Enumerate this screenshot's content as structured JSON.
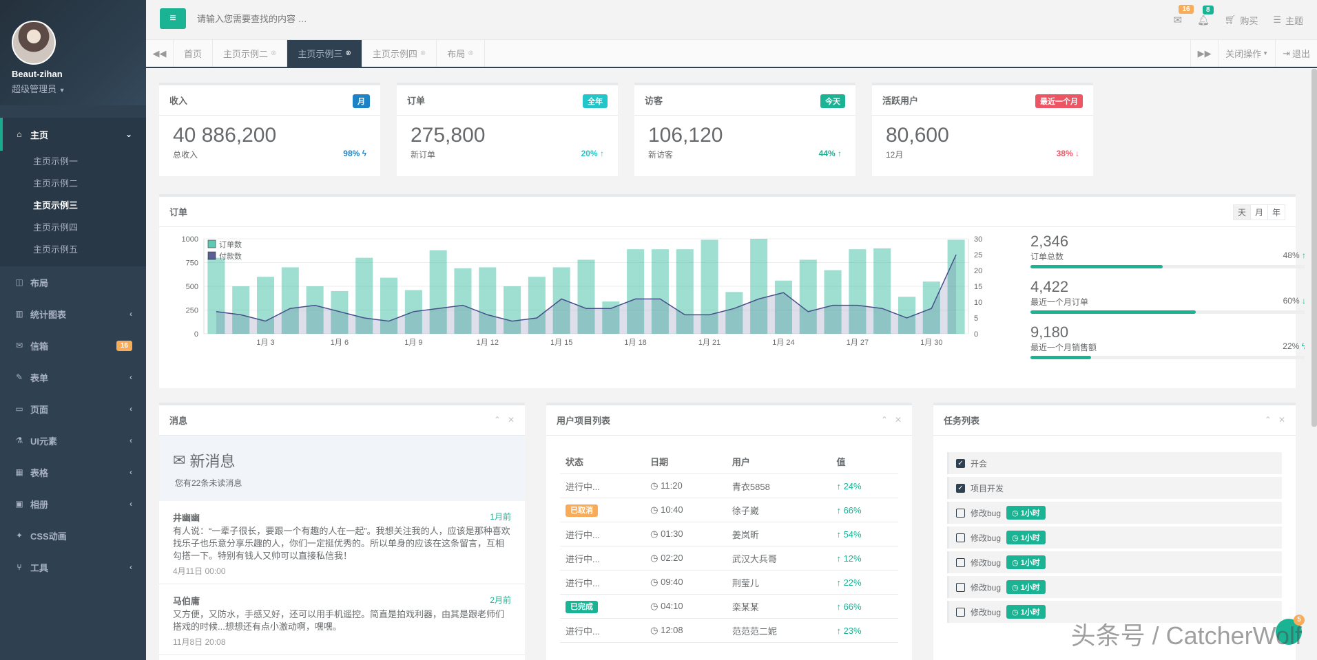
{
  "profile": {
    "name": "Beaut-zihan",
    "role": "超级管理员"
  },
  "sidebar": {
    "home": "主页",
    "home_sub": [
      "主页示例一",
      "主页示例二",
      "主页示例三",
      "主页示例四",
      "主页示例五"
    ],
    "items": [
      {
        "label": "布局",
        "icon": "layout-icon"
      },
      {
        "label": "统计图表",
        "icon": "chart-icon"
      },
      {
        "label": "信箱",
        "icon": "mail-icon",
        "badge": "16"
      },
      {
        "label": "表单",
        "icon": "edit-icon"
      },
      {
        "label": "页面",
        "icon": "desktop-icon"
      },
      {
        "label": "UI元素",
        "icon": "flask-icon"
      },
      {
        "label": "表格",
        "icon": "table-icon"
      },
      {
        "label": "相册",
        "icon": "picture-icon"
      },
      {
        "label": "CSS动画",
        "icon": "magic-icon"
      },
      {
        "label": "工具",
        "icon": "cutlery-icon"
      }
    ]
  },
  "topbar": {
    "search_placeholder": "请输入您需要查找的内容 …",
    "mail_count": "16",
    "bell_count": "8",
    "buy": "购买",
    "theme": "主题"
  },
  "tabs": {
    "items": [
      "首页",
      "主页示例二",
      "主页示例三",
      "主页示例四",
      "布局"
    ],
    "close_ops": "关闭操作",
    "logout": "退出"
  },
  "stats": [
    {
      "title": "收入",
      "label": "月",
      "label_color": "#1c84c6",
      "value": "40 886,200",
      "sub": "总收入",
      "pct": "98%",
      "pct_color": "#1c84c6",
      "arrow": "ϟ"
    },
    {
      "title": "订单",
      "label": "全年",
      "label_color": "#23c6c8",
      "value": "275,800",
      "sub": "新订单",
      "pct": "20%",
      "pct_color": "#23c6c8",
      "arrow": "↑"
    },
    {
      "title": "访客",
      "label": "今天",
      "label_color": "#1ab394",
      "value": "106,120",
      "sub": "新访客",
      "pct": "44%",
      "pct_color": "#1ab394",
      "arrow": "↑"
    },
    {
      "title": "活跃用户",
      "label": "最近一个月",
      "label_color": "#ed5565",
      "value": "80,600",
      "sub": "12月",
      "pct": "38%",
      "pct_color": "#ed5565",
      "arrow": "↓"
    }
  ],
  "orders_panel": {
    "title": "订单",
    "range_buttons": [
      "天",
      "月",
      "年"
    ],
    "side_stats": [
      {
        "value": "2,346",
        "label": "订单总数",
        "pct": "48%",
        "fill": 0.48,
        "arrow": "↑"
      },
      {
        "value": "4,422",
        "label": "最近一个月订单",
        "pct": "60%",
        "fill": 0.6,
        "arrow": "↓"
      },
      {
        "value": "9,180",
        "label": "最近一个月销售额",
        "pct": "22%",
        "fill": 0.22,
        "arrow": "ϟ"
      }
    ]
  },
  "chart_data": {
    "type": "bar",
    "x_tick_labels": [
      "1月 3",
      "1月 6",
      "1月 9",
      "1月 12",
      "1月 15",
      "1月 18",
      "1月 21",
      "1月 24",
      "1月 27",
      "1月 30"
    ],
    "y_left_ticks": [
      0,
      250,
      500,
      750,
      1000
    ],
    "y_right_ticks": [
      0,
      5,
      10,
      15,
      20,
      25,
      30
    ],
    "ylim_left": [
      0,
      1000
    ],
    "ylim_right": [
      0,
      30
    ],
    "series": [
      {
        "name": "订单数",
        "type": "bar",
        "color": "#1ab394",
        "values": [
          800,
          500,
          600,
          700,
          500,
          450,
          800,
          590,
          460,
          880,
          690,
          700,
          500,
          600,
          700,
          780,
          340,
          890,
          890,
          890,
          990,
          440,
          1000,
          560,
          780,
          670,
          890,
          900,
          390,
          550,
          990
        ]
      },
      {
        "name": "付款数",
        "type": "area",
        "color": "#464f88",
        "values": [
          7,
          6,
          4,
          8,
          9,
          7,
          5,
          4,
          7,
          8,
          9,
          6,
          4,
          5,
          11,
          8,
          8,
          11,
          11,
          6,
          6,
          8,
          11,
          13,
          7,
          9,
          9,
          8,
          5,
          8,
          25
        ]
      }
    ],
    "legend_placement": "top-left",
    "grid": true
  },
  "messages": {
    "title": "消息",
    "header": "新消息",
    "unread": "您有22条未读消息",
    "items": [
      {
        "author": "井幽幽",
        "when": "1月前",
        "text": "有人说：“一辈子很长，要跟一个有趣的人在一起”。我想关注我的人，应该是那种喜欢找乐子也乐意分享乐趣的人，你们一定挺优秀的。所以单身的应该在这条留言，互相勾搭一下。特别有钱人又帅可以直接私信我！",
        "date": "4月11日 00:00"
      },
      {
        "author": "马伯庸",
        "when": "2月前",
        "text": "又方便，又防水，手感又好，还可以用手机遥控。简直是拍戏利器，由其是跟老师们搭戏的时候...想想还有点小激动啊，嘿嘿。",
        "date": "11月8日 20:08"
      }
    ]
  },
  "projects": {
    "title": "用户项目列表",
    "headers": [
      "状态",
      "日期",
      "用户",
      "值"
    ],
    "rows": [
      {
        "status": "进行中...",
        "badge": "",
        "time": "11:20",
        "user": "青衣5858",
        "value": "24%"
      },
      {
        "status": "已取消",
        "badge": "#f8ac59",
        "time": "10:40",
        "user": "徐子崴",
        "value": "66%"
      },
      {
        "status": "进行中...",
        "badge": "",
        "time": "01:30",
        "user": "姜岚昕",
        "value": "54%"
      },
      {
        "status": "进行中...",
        "badge": "",
        "time": "02:20",
        "user": "武汉大兵哥",
        "value": "12%"
      },
      {
        "status": "进行中...",
        "badge": "",
        "time": "09:40",
        "user": "荆莹儿",
        "value": "22%"
      },
      {
        "status": "已完成",
        "badge": "#1ab394",
        "time": "04:10",
        "user": "栾某某",
        "value": "66%"
      },
      {
        "status": "进行中...",
        "badge": "",
        "time": "12:08",
        "user": "范范范二妮",
        "value": "23%"
      }
    ]
  },
  "tasks": {
    "title": "任务列表",
    "items": [
      {
        "text": "开会",
        "checked": true,
        "tag": ""
      },
      {
        "text": "项目开发",
        "checked": true,
        "tag": ""
      },
      {
        "text": "修改bug",
        "checked": false,
        "tag": "1小时"
      },
      {
        "text": "修改bug",
        "checked": false,
        "tag": "1小时"
      },
      {
        "text": "修改bug",
        "checked": false,
        "tag": "1小时"
      },
      {
        "text": "修改bug",
        "checked": false,
        "tag": "1小时"
      },
      {
        "text": "修改bug",
        "checked": false,
        "tag": "1小时"
      }
    ]
  },
  "fab_count": "5",
  "watermark": "头条号 / CatcherWolf"
}
